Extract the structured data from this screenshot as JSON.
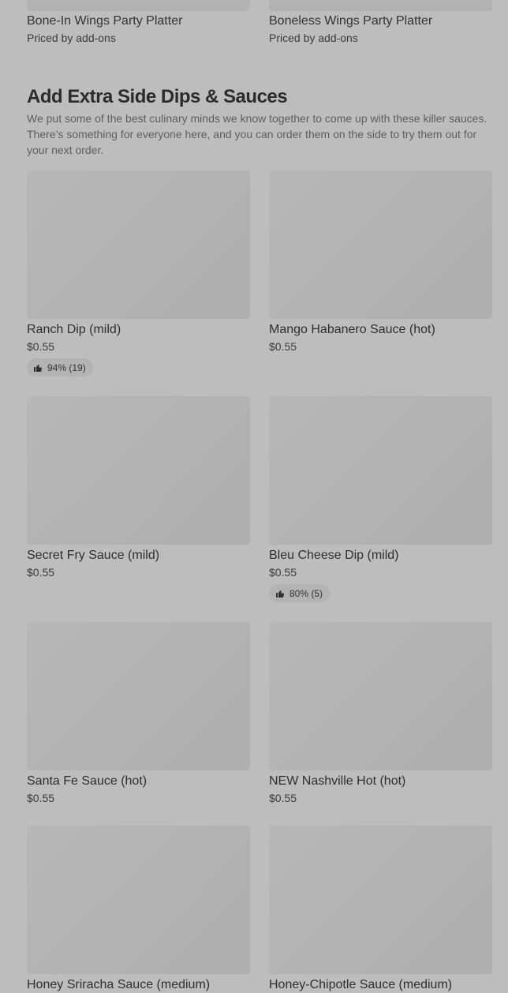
{
  "top_items": [
    {
      "title": "Bone-In Wings Party Platter",
      "subtitle": "Priced by add-ons"
    },
    {
      "title": "Boneless Wings Party Platter",
      "subtitle": "Priced by add-ons"
    }
  ],
  "section": {
    "title": "Add Extra Side Dips & Sauces",
    "description": "We put some of the best culinary minds we know together to come up with these killer sauces. There’s something for everyone here, and you can order them on the side to try them out for your next order."
  },
  "items": [
    {
      "name": "Ranch Dip (mild)",
      "price": "$0.55",
      "rating": "94% (19)"
    },
    {
      "name": "Mango Habanero Sauce (hot)",
      "price": "$0.55"
    },
    {
      "name": "Secret Fry Sauce (mild)",
      "price": "$0.55"
    },
    {
      "name": "Bleu Cheese Dip (mild)",
      "price": "$0.55",
      "rating": "80% (5)"
    },
    {
      "name": "Santa Fe Sauce (hot)",
      "price": "$0.55"
    },
    {
      "name": "NEW Nashville Hot (hot)",
      "price": "$0.55"
    },
    {
      "name": "Honey Sriracha Sauce (medium)"
    },
    {
      "name": "Honey-Chipotle Sauce (medium)"
    }
  ],
  "icons": {
    "rating": "thumbs-up-icon"
  },
  "colors": {
    "background": "#bdbdbd",
    "placeholder": "#b2b2b2",
    "badge": "#b3b3b3"
  }
}
